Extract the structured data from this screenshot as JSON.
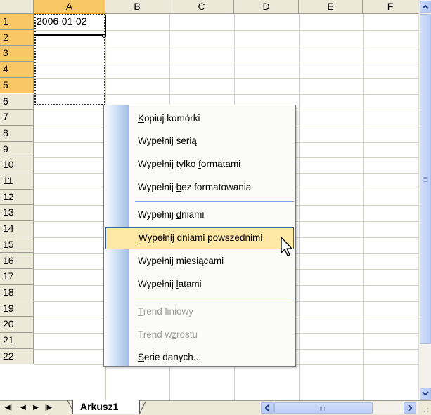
{
  "columns": [
    "A",
    "B",
    "C",
    "D",
    "E",
    "F"
  ],
  "rows": [
    "1",
    "2",
    "3",
    "4",
    "5",
    "6",
    "7",
    "8",
    "9",
    "10",
    "11",
    "12",
    "13",
    "14",
    "15",
    "16",
    "17",
    "18",
    "19",
    "20",
    "21",
    "22"
  ],
  "cell_a1": "2006-01-02",
  "menu": {
    "items": [
      {
        "pre": "",
        "key": "K",
        "post": "opiuj komórki",
        "disabled": false
      },
      {
        "pre": "",
        "key": "W",
        "post": "ypełnij serią",
        "disabled": false
      },
      {
        "pre": "Wypełnij tylko ",
        "key": "f",
        "post": "ormatami",
        "disabled": false
      },
      {
        "pre": "Wypełnij ",
        "key": "b",
        "post": "ez formatowania",
        "disabled": false
      },
      {
        "pre": "Wypełnij ",
        "key": "d",
        "post": "niami",
        "disabled": false
      },
      {
        "pre": "",
        "key": "W",
        "post": "ypełnij dniami powszednimi",
        "disabled": false,
        "hover": true
      },
      {
        "pre": "Wypełnij ",
        "key": "m",
        "post": "iesiącami",
        "disabled": false
      },
      {
        "pre": "Wypełnij ",
        "key": "l",
        "post": "atami",
        "disabled": false
      },
      {
        "pre": "",
        "key": "T",
        "post": "rend liniowy",
        "disabled": true
      },
      {
        "pre": "Trend w",
        "key": "z",
        "post": "rostu",
        "disabled": true
      },
      {
        "pre": "",
        "key": "S",
        "post": "erie danych...",
        "disabled": false
      }
    ]
  },
  "sheet_tab": "Arkusz1",
  "colors": {
    "highlight": "#ffe8a6",
    "header_selected": "#f8c866",
    "menu_separator": "#7d9fd0"
  }
}
